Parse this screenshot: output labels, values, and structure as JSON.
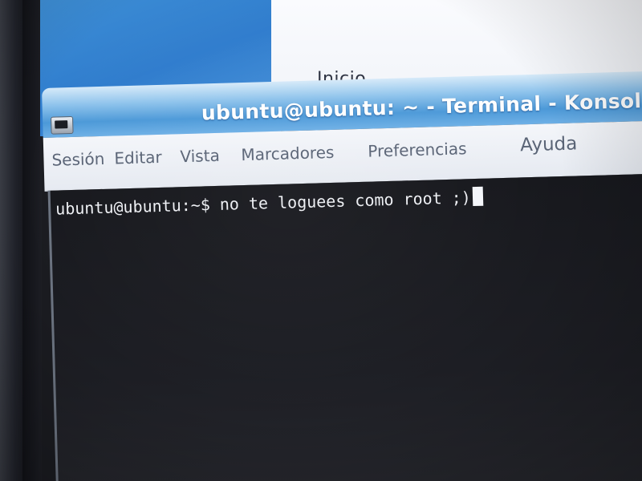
{
  "back_window": {
    "title": "Inicio"
  },
  "terminal": {
    "title": "ubuntu@ubuntu: ~ - Terminal - Konsol",
    "menu": [
      {
        "label": "Sesión"
      },
      {
        "label": "Editar"
      },
      {
        "label": "Vista"
      },
      {
        "label": "Marcadores"
      },
      {
        "label": "Preferencias"
      },
      {
        "label": "Ayuda"
      }
    ],
    "prompt": "ubuntu@ubuntu:~$",
    "command": " no te loguees como root ;)"
  },
  "icons": {
    "window_icon": "konsole-terminal-icon"
  },
  "colors": {
    "titlebar_accent": "#4c99d8",
    "desktop_blue": "#2f7ccd",
    "terminal_bg": "#1a1b20",
    "terminal_text": "#eef0f4"
  }
}
